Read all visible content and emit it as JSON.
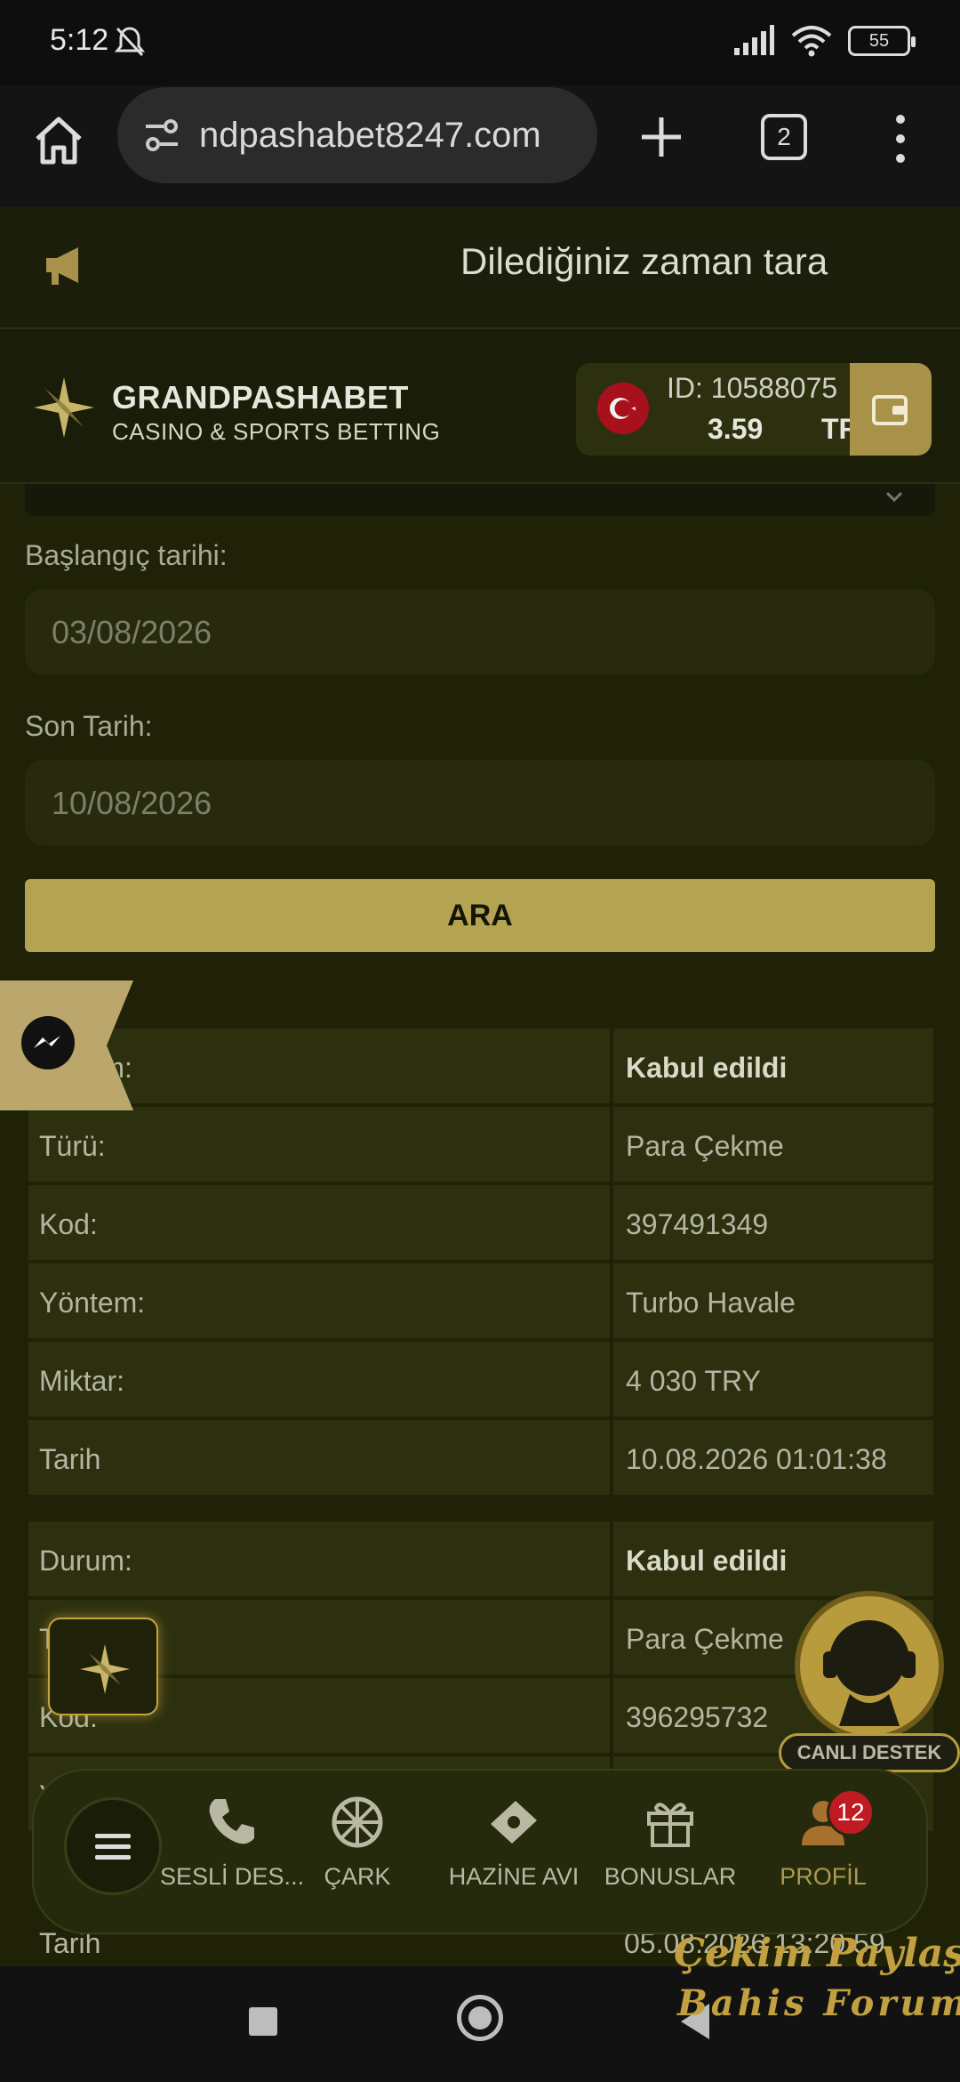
{
  "status": {
    "time": "5:12",
    "battery": "55"
  },
  "browser": {
    "url": "ndpashabet8247.com",
    "tab_count": "2"
  },
  "announcement": {
    "text": "Dilediğiniz zaman tara"
  },
  "header": {
    "brand": "GRANDPASHABET",
    "tagline": "CASINO & SPORTS BETTING",
    "account_id": "ID: 10588075",
    "balance": "3.59",
    "currency": "TRY"
  },
  "form": {
    "start_label": "Başlangıç tarihi:",
    "start_value": "03/08/2026",
    "end_label": "Son Tarih:",
    "end_value": "10/08/2026",
    "search_button": "ARA"
  },
  "transactions": [
    {
      "rows": [
        {
          "label": "Durum:",
          "value": "Kabul edildi"
        },
        {
          "label": "Türü:",
          "value": "Para Çekme"
        },
        {
          "label": "Kod:",
          "value": "397491349"
        },
        {
          "label": "Yöntem:",
          "value": "Turbo Havale"
        },
        {
          "label": "Miktar:",
          "value": "4 030 TRY"
        },
        {
          "label": "Tarih",
          "value": "10.08.2026 01:01:38"
        }
      ]
    },
    {
      "rows": [
        {
          "label": "Durum:",
          "value": "Kabul edildi"
        },
        {
          "label": "Türü:",
          "value": "Para Çekme"
        },
        {
          "label": "Kod:",
          "value": "396295732"
        },
        {
          "label": "Yöntem:",
          "value": ""
        },
        {
          "label": "Tarih",
          "value": "05.08.2026 13:20:59"
        }
      ]
    }
  ],
  "live_support": {
    "label": "CANLI DESTEK"
  },
  "bottom_nav": {
    "items": [
      {
        "label": "SESLİ DES..."
      },
      {
        "label": "ÇARK"
      },
      {
        "label": "HAZİNE AVI"
      },
      {
        "label": "BONUSLAR"
      },
      {
        "label": "PROFİL",
        "badge": "12"
      }
    ]
  },
  "watermark": {
    "line1": "Çekim Paylaş",
    "line2": "Bahis Forum"
  },
  "colors": {
    "accent": "#b4a451",
    "overlay": "#1f2207",
    "badge": "#c01a22"
  }
}
